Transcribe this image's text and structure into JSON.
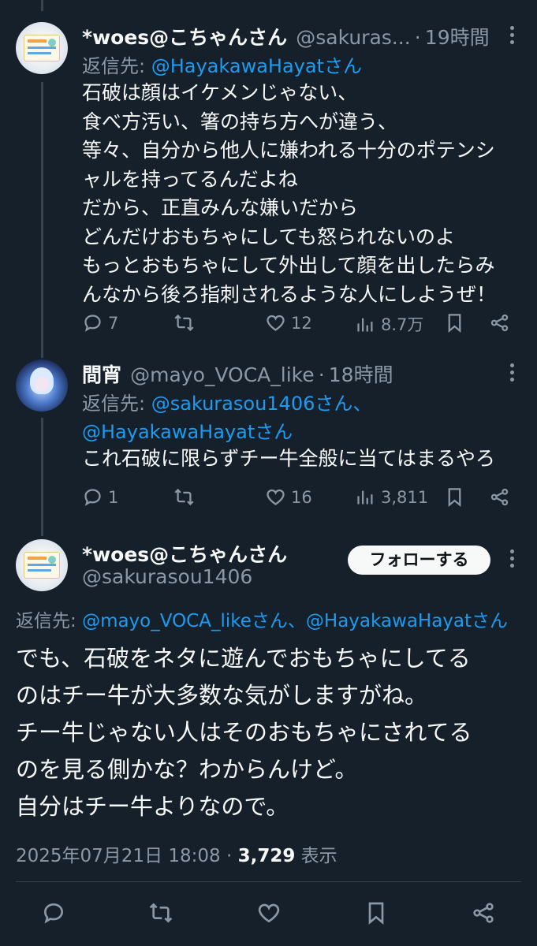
{
  "tweets": [
    {
      "display_name": "*woes@こちゃんさん",
      "handle": "@sakuras...",
      "sep": "·",
      "time": "19時間",
      "reply_prefix": "返信先: ",
      "reply_mentions": "@HayakawaHayatさん",
      "body": "石破は顔はイケメンじゃない、\n食べ方汚い、箸の持ち方へが違う、\n等々、自分から他人に嫌われる十分のポテンシ\nャルを持ってるんだよね\nだから、正直みんな嫌いだから\nどんだけおもちゃにしても怒られないのよ\nもっとおもちゃにして外出して顔を出したらみ\nんなから後ろ指刺されるような人にしようぜ！",
      "replies": "7",
      "retweets": "",
      "likes": "12",
      "views": "8.7万"
    },
    {
      "display_name": "間宵",
      "handle": "@mayo_VOCA_like",
      "sep": "·",
      "time": "18時間",
      "reply_prefix": "返信先: ",
      "reply_mentions_line1": "@sakurasou1406さん、",
      "reply_mentions_line2": "@HayakawaHayatさん",
      "body": "これ石破に限らずチー牛全般に当てはまるやろ",
      "replies": "1",
      "retweets": "",
      "likes": "16",
      "views": "3,811"
    }
  ],
  "main_tweet": {
    "display_name": "*woes@こちゃんさん",
    "handle": "@sakurasou1406",
    "follow_label": "フォローする",
    "reply_prefix": "返信先: ",
    "reply_mentions": "@mayo_VOCA_likeさん、@HayakawaHayatさん",
    "body": "でも、石破をネタに遊んでおもちゃにしてる\nのはチー牛が大多数な気がしますがね。\nチー牛じゃない人はそのおもちゃにされてる\nのを見る側かな？わからんけど。\n自分はチー牛よりなので。",
    "timestamp": "2025年07月21日 18:08 · ",
    "views_count": "3,729",
    "views_label": " 表示"
  },
  "icons": {
    "reply": "reply-icon",
    "retweet": "retweet-icon",
    "like": "heart-icon",
    "views": "views-icon",
    "bookmark": "bookmark-icon",
    "share": "share-icon",
    "more": "more-icon"
  },
  "colors": {
    "background": "#15202b",
    "text": "#f7f9f9",
    "secondary": "#8b98a5",
    "link": "#1d9bf0",
    "divider": "#38444d"
  }
}
